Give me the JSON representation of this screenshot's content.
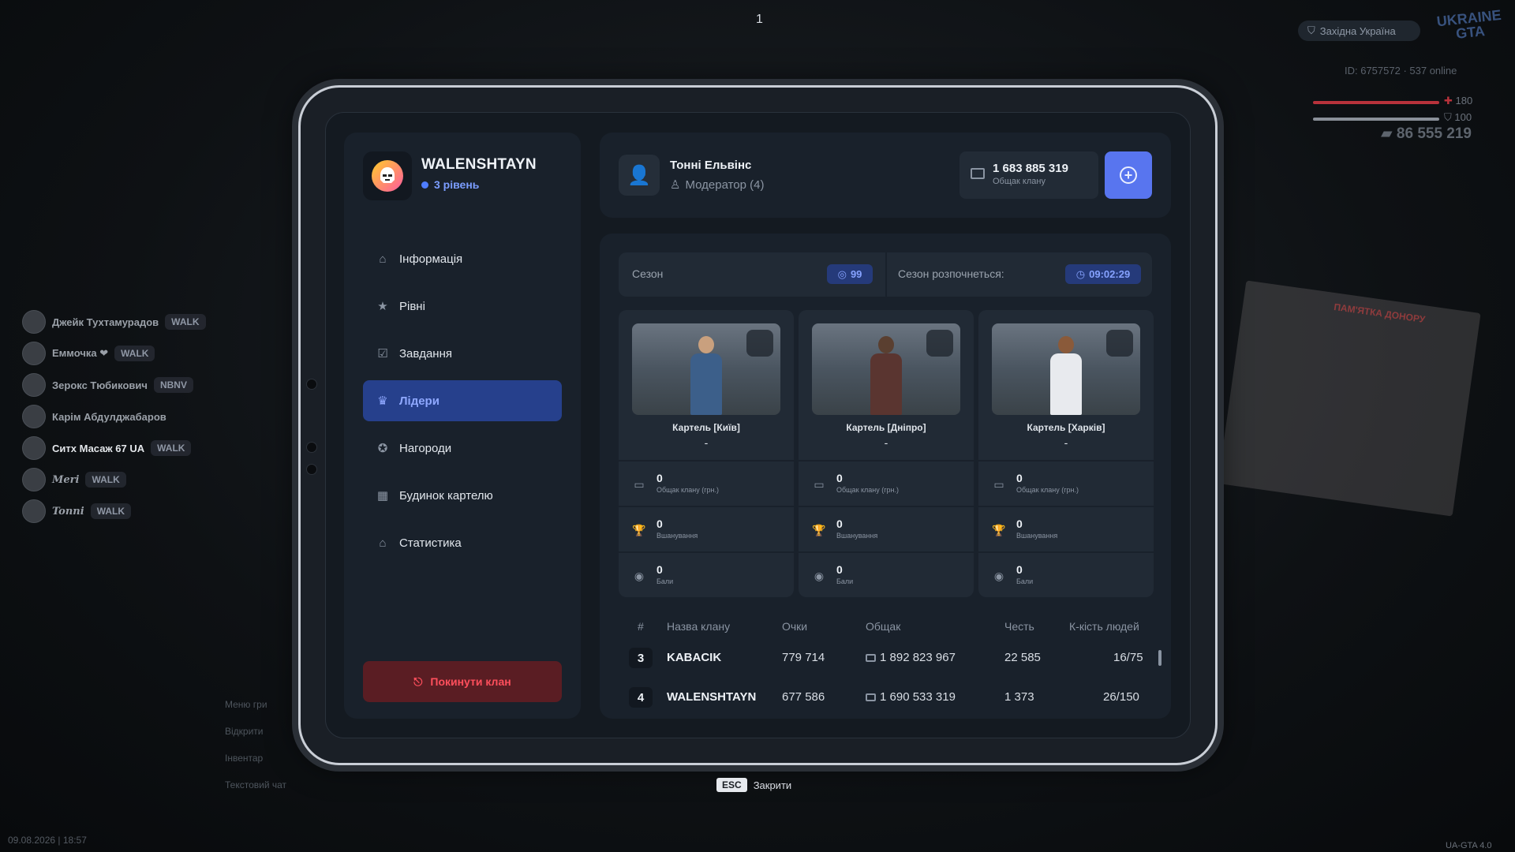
{
  "hud": {
    "top_number": "1",
    "region": "Західна Україна",
    "logo": "UKRAINE GTA",
    "id_online": "ID: 6757572  ·  537 online",
    "health": "180",
    "armor": "100",
    "money": "86 555 219",
    "date": "09.08.2026 | 18:57",
    "version": "UA-GTA 4.0",
    "poster_title": "ПАМ'ЯТКА ДОНОРУ",
    "hints": [
      "Меню гри",
      "Відкрити",
      "Інвентар",
      "Текстовий чат"
    ],
    "chat": [
      {
        "name": "Джейк Тухтамурадов",
        "tag": "WALK"
      },
      {
        "name": "Еммочка ❤",
        "tag": "WALK"
      },
      {
        "name": "Зерокс Тюбикович",
        "tag": "NBNV"
      },
      {
        "name": "Карім Абдулджабаров",
        "tag": ""
      },
      {
        "name": "Ситх Масаж 67 UA",
        "tag": "WALK"
      },
      {
        "name": "Meri",
        "tag": "WALK"
      },
      {
        "name": "Tonni",
        "tag": "WALK"
      }
    ]
  },
  "sidebar": {
    "clan_name": "WALENSHTAYN",
    "clan_level": "3 рівень",
    "menu": [
      {
        "label": "Інформація",
        "icon": "home-icon"
      },
      {
        "label": "Рівні",
        "icon": "star-icon"
      },
      {
        "label": "Завдання",
        "icon": "checkbox-icon"
      },
      {
        "label": "Лідери",
        "icon": "crown-icon",
        "active": true
      },
      {
        "label": "Нагороди",
        "icon": "medal-icon"
      },
      {
        "label": "Будинок картелю",
        "icon": "building-icon"
      },
      {
        "label": "Статистика",
        "icon": "store-icon"
      }
    ],
    "leave_button": "Покинути клан"
  },
  "header": {
    "user_name": "Тонні Ельвінс",
    "user_role": "Модератор (4)",
    "bank_value": "1 683 885 319",
    "bank_label": "Общак клану"
  },
  "season": {
    "label": "Сезон",
    "badge": "99",
    "start_label": "Сезон розпочнеться:",
    "timer": "09:02:29"
  },
  "cards": [
    {
      "title": "Картель [Київ]",
      "owner": "-",
      "stats": [
        {
          "value": "0",
          "label": "Общак клану (грн.)"
        },
        {
          "value": "0",
          "label": "Вшанування"
        },
        {
          "value": "0",
          "label": "Бали"
        }
      ]
    },
    {
      "title": "Картель [Дніпро]",
      "owner": "-",
      "stats": [
        {
          "value": "0",
          "label": "Общак клану (грн.)"
        },
        {
          "value": "0",
          "label": "Вшанування"
        },
        {
          "value": "0",
          "label": "Бали"
        }
      ]
    },
    {
      "title": "Картель [Харків]",
      "owner": "-",
      "stats": [
        {
          "value": "0",
          "label": "Общак клану (грн.)"
        },
        {
          "value": "0",
          "label": "Вшанування"
        },
        {
          "value": "0",
          "label": "Бали"
        }
      ]
    }
  ],
  "table": {
    "headers": [
      "#",
      "Назва клану",
      "Очки",
      "Общак",
      "Честь",
      "К-кість людей"
    ],
    "rows": [
      {
        "rank": "3",
        "name": "KABACIK",
        "points": "779 714",
        "bank": "1 892 823 967",
        "honor": "22 585",
        "people": "16/75"
      },
      {
        "rank": "4",
        "name": "WALENSHTAYN",
        "points": "677 586",
        "bank": "1 690 533 319",
        "honor": "1 373",
        "people": "26/150"
      }
    ]
  },
  "footer": {
    "esc_key": "ESC",
    "close_label": "Закрити"
  }
}
